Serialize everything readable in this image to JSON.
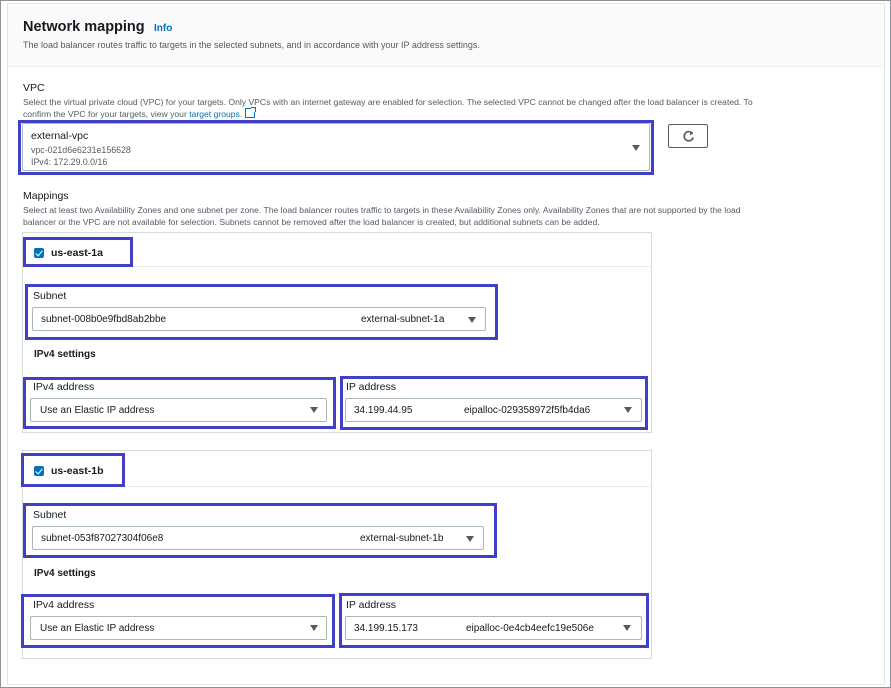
{
  "section": {
    "title": "Network mapping",
    "info": "Info",
    "description": "The load balancer routes traffic to targets in the selected subnets, and in accordance with your IP address settings."
  },
  "vpc": {
    "label": "VPC",
    "description": "Select the virtual private cloud (VPC) for your targets. Only VPCs with an internet gateway are enabled for selection. The selected VPC cannot be changed after the load balancer is created. To",
    "description2": "confirm the VPC for your targets, view your",
    "link": "target groups",
    "selected_name": "external-vpc",
    "selected_id": "vpc-021d6e6231e156628",
    "selected_ipv4": "IPv4: 172.29.0.0/16",
    "refresh_icon": "refresh-icon"
  },
  "mappings": {
    "label": "Mappings",
    "description": "Select at least two Availability Zones and one subnet per zone. The load balancer routes traffic to targets in these Availability Zones only. Availability Zones that are not supported by the load",
    "description2": "balancer or the VPC are not available for selection. Subnets cannot be removed after the load balancer is created, but additional subnets can be added.",
    "zones": [
      {
        "name": "us-east-1a",
        "checked": true,
        "subnet_label": "Subnet",
        "subnet_id": "subnet-008b0e9fbd8ab2bbe",
        "subnet_name": "external-subnet-1a",
        "ipv4_settings": "IPv4 settings",
        "ipv4_address_label": "IPv4 address",
        "ipv4_address_value": "Use an Elastic IP address",
        "ip_address_label": "IP address",
        "ip_address_value": "34.199.44.95",
        "eip_alloc": "eipalloc-029358972f5fb4da6"
      },
      {
        "name": "us-east-1b",
        "checked": true,
        "subnet_label": "Subnet",
        "subnet_id": "subnet-053f87027304f06e8",
        "subnet_name": "external-subnet-1b",
        "ipv4_settings": "IPv4 settings",
        "ipv4_address_label": "IPv4 address",
        "ipv4_address_value": "Use an Elastic IP address",
        "ip_address_label": "IP address",
        "ip_address_value": "34.199.15.173",
        "eip_alloc": "eipalloc-0e4cb4eefc19e506e"
      }
    ]
  },
  "colors": {
    "highlight": "#3f3fc8",
    "link": "#0073bb",
    "checkbox": "#0073bb"
  }
}
